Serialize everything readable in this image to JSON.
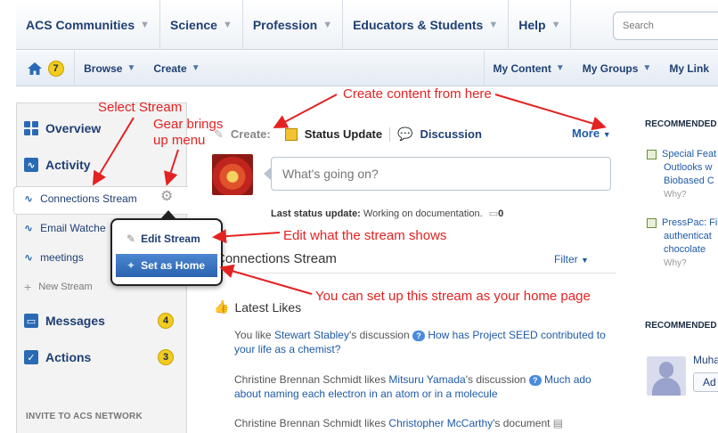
{
  "topnav": {
    "items": [
      "ACS Communities",
      "Science",
      "Profession",
      "Educators & Students",
      "Help"
    ],
    "search_placeholder": "Search"
  },
  "subnav": {
    "home_badge": "7",
    "items": [
      "Browse",
      "Create"
    ],
    "right_items": [
      "My Content",
      "My Groups",
      "My Link"
    ]
  },
  "sidebar": {
    "overview": "Overview",
    "activity": "Activity",
    "streams": [
      "Connections Stream",
      "Email Watches",
      "meetings"
    ],
    "new_stream": "New Stream",
    "messages": "Messages",
    "messages_count": "4",
    "actions": "Actions",
    "actions_count": "3",
    "invite": "INVITE TO ACS NETWORK"
  },
  "gear_menu": {
    "edit": "Edit Stream",
    "home": "Set as Home"
  },
  "main": {
    "create_label": "Create:",
    "status_update": "Status Update",
    "discussion": "Discussion",
    "more": "More",
    "status_placeholder": "What's going on?",
    "last_status_label": "Last status update:",
    "last_status_text": "Working on documentation.",
    "comment_count": "0",
    "stream_title": "Connections Stream",
    "filter": "Filter",
    "latest_likes": "Latest Likes",
    "feed": [
      {
        "a": "You like ",
        "user": "Stewart Stabley",
        "b": "'s discussion ",
        "link": "How has Project SEED contributed to your life as a chemist?"
      },
      {
        "pre": "Christine Brennan Schmidt",
        "a": " likes ",
        "user": "Mitsuru Yamada",
        "b": "'s discussion ",
        "link": "Much ado about naming each electron in an atom or in a molecule"
      },
      {
        "pre": "Christine Brennan Schmidt",
        "a": " likes ",
        "user": "Christopher McCarthy",
        "b": "'s document"
      }
    ]
  },
  "right": {
    "head1": "RECOMMENDED",
    "rec1_lines": [
      "Special Feat",
      "Outlooks w",
      "Biobased C"
    ],
    "rec2_lines": [
      "PressPac: Fi",
      "authenticat",
      "chocolate"
    ],
    "why": "Why?",
    "head2": "RECOMMENDED",
    "person_name": "Muha",
    "add_button": "Ad"
  },
  "annotations": {
    "select_stream": "Select Stream",
    "gear_menu": [
      "Gear brings",
      "up menu"
    ],
    "create_content": "Create content from here",
    "edit_stream": "Edit what the stream shows",
    "set_home": "You can set up this stream as your home page"
  },
  "colors": {
    "nav_text": "#1f3f73",
    "link": "#1f5aa6",
    "badge": "#f2cc1e",
    "annotation": "#e32222",
    "menu_active": "#2a63b0"
  }
}
